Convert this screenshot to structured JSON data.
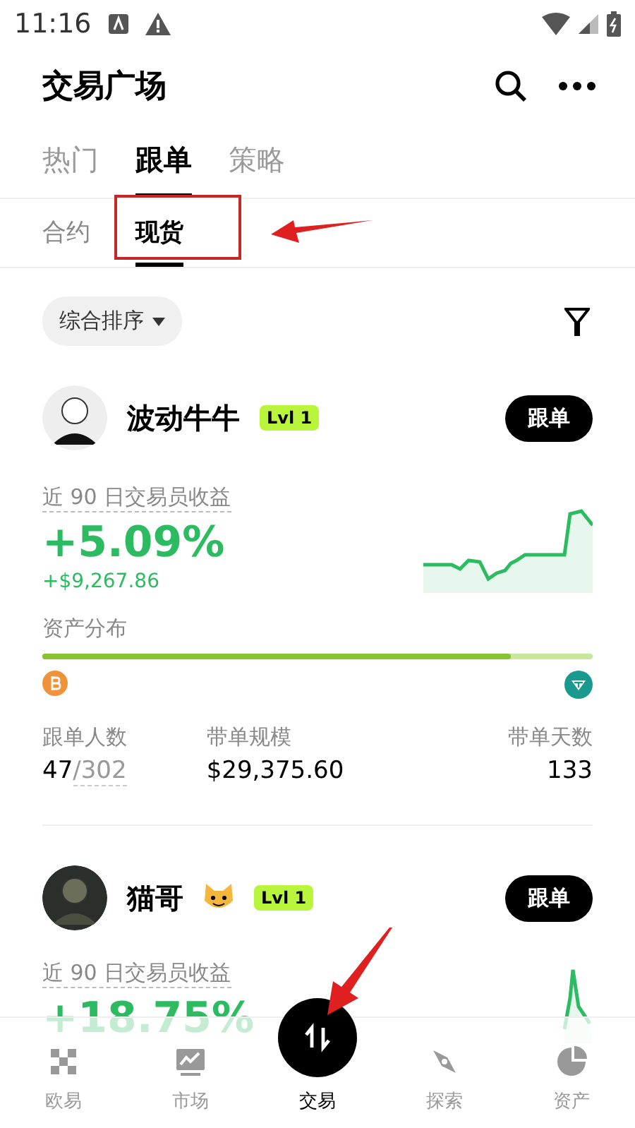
{
  "status_bar": {
    "time": "11:16"
  },
  "header": {
    "title": "交易广场"
  },
  "tabs": [
    {
      "label": "热门",
      "selected": false
    },
    {
      "label": "跟单",
      "selected": true
    },
    {
      "label": "策略",
      "selected": false
    }
  ],
  "sub_tabs": [
    {
      "label": "合约",
      "selected": false
    },
    {
      "label": "现货",
      "selected": true
    }
  ],
  "sort": {
    "label": "综合排序"
  },
  "traders": [
    {
      "name": "波动牛牛",
      "badge": "Lvl 1",
      "follow": "跟单",
      "metric_label": "近 90 日交易员收益",
      "return_pct": "+5.09%",
      "return_amount": "+$9,267.86",
      "allocation": {
        "label": "资产分布",
        "level": 0.85
      },
      "stats": [
        {
          "label": "跟单人数",
          "value": "47",
          "suffix": "/302"
        },
        {
          "label": "带单规模",
          "value": "$29,375.60"
        },
        {
          "label": "带单天数",
          "value": "133"
        }
      ]
    },
    {
      "name": "猫哥",
      "badge": "Lvl 1",
      "follow": "跟单",
      "metric_label": "近 90 日交易员收益",
      "return_pct": "+18.75%"
    }
  ],
  "bottom_nav": [
    {
      "label": "欧易",
      "selected": false
    },
    {
      "label": "市场",
      "selected": false
    },
    {
      "label": "交易",
      "selected": true
    },
    {
      "label": "探索",
      "selected": false
    },
    {
      "label": "资产",
      "selected": false
    }
  ]
}
